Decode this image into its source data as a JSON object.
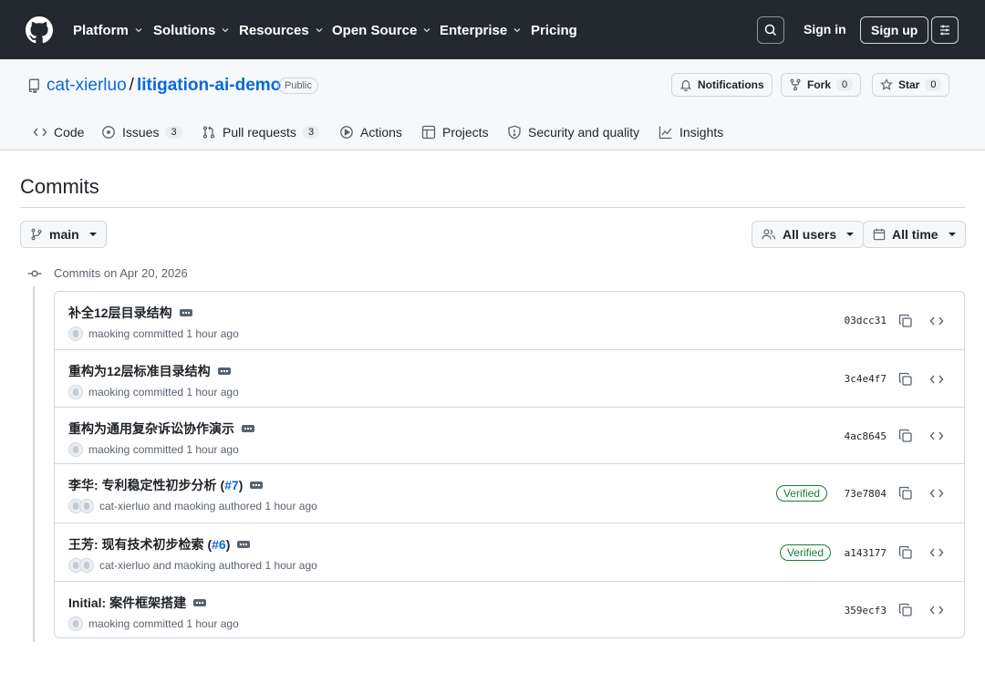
{
  "header": {
    "nav": [
      "Platform",
      "Solutions",
      "Resources",
      "Open Source",
      "Enterprise",
      "Pricing"
    ],
    "signin": "Sign in",
    "signup": "Sign up"
  },
  "repo": {
    "owner": "cat-xierluo",
    "separator": "/",
    "name": "litigation-ai-demo",
    "visibility": "Public",
    "notifications": "Notifications",
    "fork_label": "Fork",
    "fork_count": "0",
    "star_label": "Star",
    "star_count": "0"
  },
  "tabs": {
    "code": "Code",
    "issues": "Issues",
    "issues_count": "3",
    "pulls": "Pull requests",
    "pulls_count": "3",
    "actions": "Actions",
    "projects": "Projects",
    "security": "Security and quality",
    "insights": "Insights"
  },
  "page": {
    "title": "Commits",
    "branch": "main",
    "users_filter": "All users",
    "time_filter": "All time",
    "group_date": "Commits on Apr 20, 2026"
  },
  "commits": [
    {
      "message": "补全12层目录结构",
      "pr_open": "",
      "pr": "",
      "pr_close": "",
      "author": "maoking committed 1 hour ago",
      "verified": "",
      "sha": "03dcc31"
    },
    {
      "message": "重构为12层标准目录结构",
      "pr_open": "",
      "pr": "",
      "pr_close": "",
      "author": "maoking committed 1 hour ago",
      "verified": "",
      "sha": "3c4e4f7"
    },
    {
      "message": "重构为通用复杂诉讼协作演示",
      "pr_open": "",
      "pr": "",
      "pr_close": "",
      "author": "maoking committed 1 hour ago",
      "verified": "",
      "sha": "4ac8645"
    },
    {
      "message": "李华: 专利稳定性初步分析",
      "pr_open": " (",
      "pr": "#7",
      "pr_close": ")",
      "author": "cat-xierluo and maoking authored 1 hour ago",
      "verified": "Verified",
      "sha": "73e7804"
    },
    {
      "message": "王芳: 现有技术初步检索",
      "pr_open": " (",
      "pr": "#6",
      "pr_close": ")",
      "author": "cat-xierluo and maoking authored 1 hour ago",
      "verified": "Verified",
      "sha": "a143177"
    },
    {
      "message": "Initial: 案件框架搭建",
      "pr_open": "",
      "pr": "",
      "pr_close": "",
      "author": "maoking committed 1 hour ago",
      "verified": "",
      "sha": "359ecf3"
    }
  ]
}
